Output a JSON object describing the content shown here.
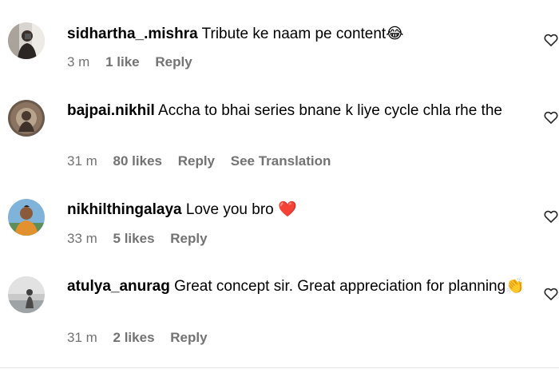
{
  "comments": [
    {
      "username": "sidhartha_.mishra",
      "text": "Tribute ke naam pe content",
      "emoji": "😂",
      "time": "3 m",
      "likes": "1 like",
      "reply": "Reply",
      "translation": "",
      "avatar_icon": "avatar-photo"
    },
    {
      "username": "bajpai.nikhil",
      "text": "Accha to bhai series bnane k liye cycle chla rhe the",
      "emoji": "",
      "time": "31 m",
      "likes": "80 likes",
      "reply": "Reply",
      "translation": "See Translation",
      "avatar_icon": "avatar-photo"
    },
    {
      "username": "nikhilthingalaya",
      "text": "Love you bro",
      "emoji": "❤️",
      "time": "33 m",
      "likes": "5 likes",
      "reply": "Reply",
      "translation": "",
      "avatar_icon": "avatar-photo"
    },
    {
      "username": "atulya_anurag",
      "text": "Great concept sir. Great appreciation for planning",
      "emoji": "👏",
      "time": "31 m",
      "likes": "2 likes",
      "reply": "Reply",
      "translation": "",
      "avatar_icon": "avatar-photo"
    }
  ],
  "colors": {
    "meta_text": "#737373",
    "divider": "#e6e6e6"
  }
}
